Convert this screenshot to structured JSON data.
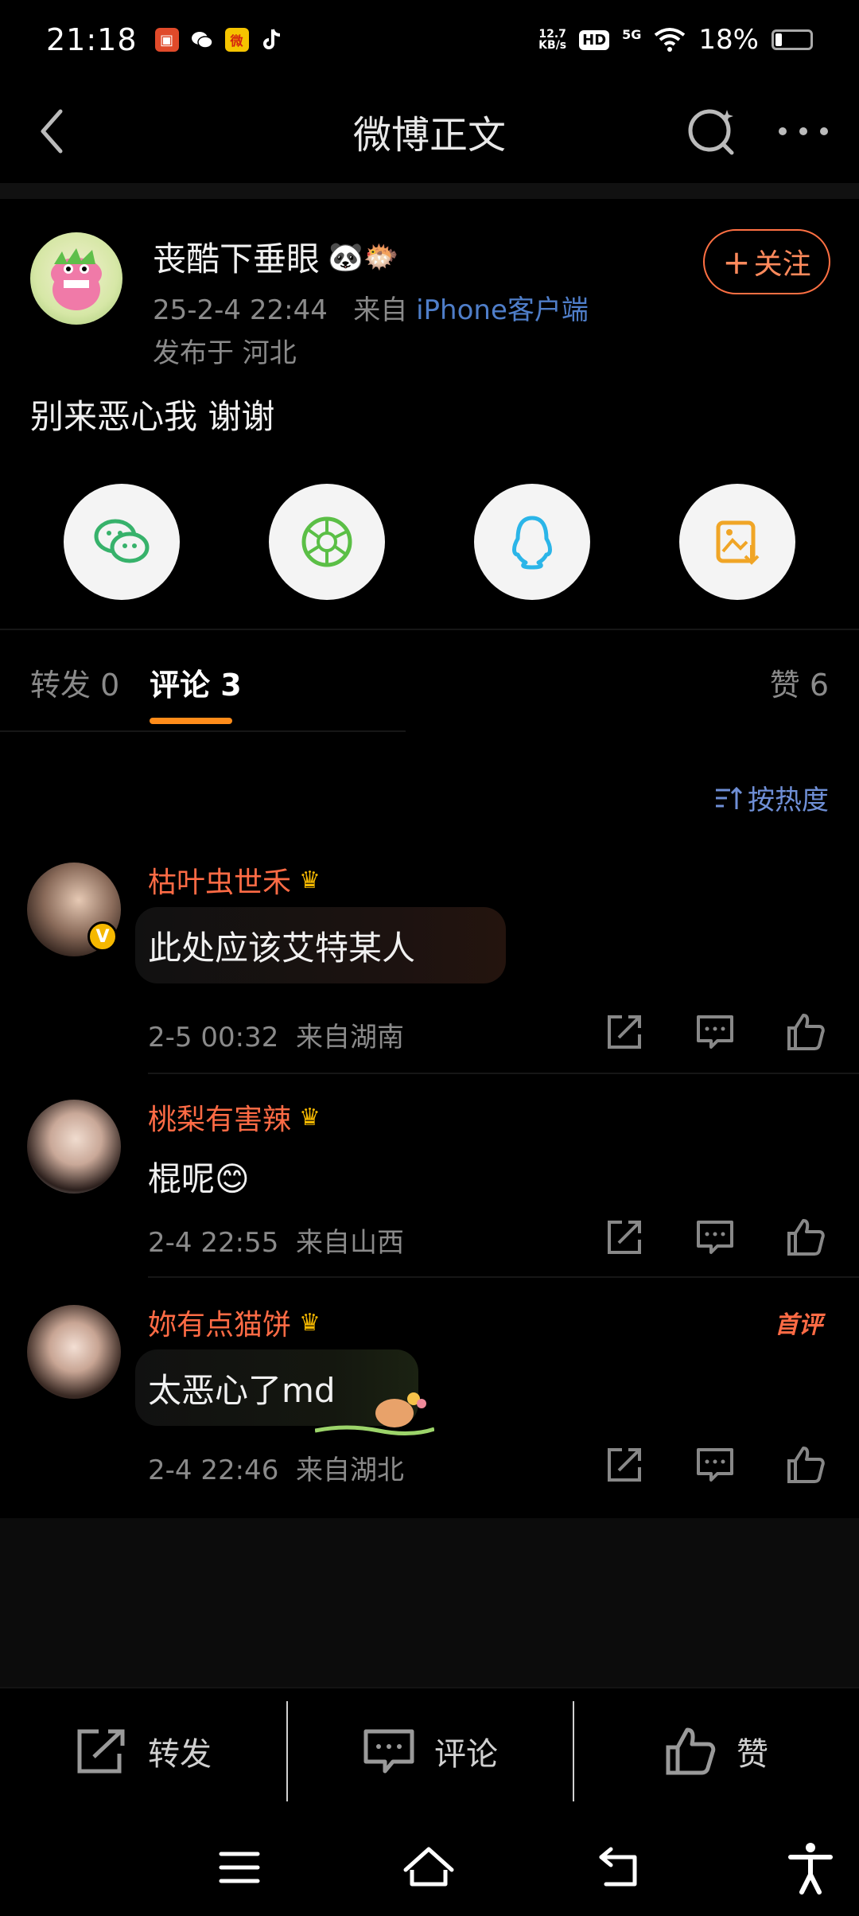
{
  "status_bar": {
    "time": "21:18",
    "net_speed_value": "12.7",
    "net_speed_unit": "KB/s",
    "hd": "HD",
    "network": "5G",
    "battery": "18%",
    "battery_level": 0.18,
    "app_icons": [
      "app-icon",
      "wechat-icon",
      "weibo-icon",
      "tiktok-icon"
    ]
  },
  "nav": {
    "title": "微博正文"
  },
  "post": {
    "username": "丧酷下垂眼",
    "username_emojis": "🐼🐡",
    "date": "25-2-4 22:44",
    "from_prefix": "来自",
    "source": "iPhone客户端",
    "location": "发布于 河北",
    "follow_label": "关注",
    "follow_plus": "+",
    "text": "别来恶心我 谢谢"
  },
  "share_targets": [
    "wechat-icon",
    "moments-icon",
    "qq-icon",
    "save-image-icon"
  ],
  "tabs": {
    "repost": "转发 0",
    "comments": "评论 3",
    "likes": "赞 6"
  },
  "sort": {
    "label": "按热度"
  },
  "comments": [
    {
      "name": "枯叶虫世禾",
      "text": "此处应该艾特某人",
      "time": "2-5 00:32",
      "from": "来自湖南",
      "badge": "V"
    },
    {
      "name": "桃梨有害辣",
      "text": "棍呢😊",
      "time": "2-4 22:55",
      "from": "来自山西"
    },
    {
      "name": "妳有点猫饼",
      "text": "太恶心了md",
      "time": "2-4 22:46",
      "from": "来自湖北",
      "tag": "首评"
    }
  ],
  "actions": {
    "repost": "转发",
    "comment": "评论",
    "like": "赞"
  },
  "colors": {
    "accent_orange": "#ff8c1a",
    "name_red": "#ff6b45",
    "link_blue": "#4f7ec9",
    "sort_blue": "#6f8fd6"
  }
}
